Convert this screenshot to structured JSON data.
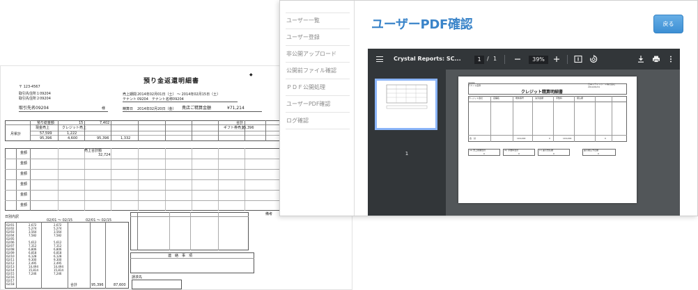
{
  "document": {
    "title": "預り金返還明細書",
    "postal": "〒 123-4567",
    "client_id1": "取引先住所１09204",
    "client_id2": "取引先住所２09204",
    "client_name": "取引先名09204",
    "honorific": "様",
    "sales_period_label": "売上期間",
    "sales_period": "2014年02月01日（土） ～ 2014年02月15日（土）",
    "tenant_label": "テナント",
    "tenant": "09204　テナント名称09204",
    "issue_date_label": "精算日",
    "issue_date": "2014年02月20日（金）",
    "return_label": "貴店ご精算金額",
    "return_amount": "¥71,214",
    "row_header1": "預り総金額",
    "row_header2": "現金売上",
    "row_header3": "クレジット売上",
    "row_header4": "ギフト券売上",
    "total_label": "合計",
    "monthly_label": "月累計",
    "amount_label": "金額",
    "col_sales_total": "売上合計額",
    "sales_total": "95,396",
    "totals_row": "95,396",
    "val_a": "57,599",
    "val_b": "15",
    "val_c": "7,402",
    "val_d": "1,222",
    "val_e": "4,600",
    "val_f": "1,332",
    "val_g": "32,724",
    "daily_label": "日別内訳",
    "daily_period1": "02/01 ～ 02/15",
    "daily_period2": "02/01 ～ 02/15",
    "daily_rows": [
      "02/01",
      "02/02",
      "02/03",
      "02/04",
      "02/05",
      "02/06",
      "02/07",
      "02/08",
      "02/09",
      "02/10",
      "02/11",
      "02/12",
      "02/13",
      "02/14",
      "02/15",
      "02/16",
      "02/17",
      "02/18"
    ],
    "daily_vals": [
      "2,672",
      "5,274",
      "3,564",
      "7,582",
      "",
      "5,612",
      "7,312",
      "6,806",
      "6,818",
      "6,128",
      "9,300",
      "2,495",
      "14,494",
      "15,814",
      "7,246",
      "",
      "",
      ""
    ],
    "daily_total_label": "合計",
    "daily_total": "95,396",
    "daily_total2": "87,600",
    "note_header": "連　絡　事　項",
    "bottom_label": "請求先",
    "remarks_label": "備考"
  },
  "window": {
    "menu": [
      "ユーザー一覧",
      "ユーザー登録",
      "非公開アップロード",
      "公開前ファイル確認",
      "ＰＤＦ公開処理",
      "ユーザーPDF確認",
      "ログ確認"
    ],
    "page_title": "ユーザーPDF確認",
    "back_label": "戻る"
  },
  "viewer": {
    "doc_title": "Crystal Reports: SC...",
    "page_current": "1",
    "page_sep": "/",
    "page_total": "1",
    "zoom": "39%",
    "thumb_label": "1"
  },
  "pdf_page": {
    "title": "クレジット精算明細書",
    "header_left1": "00000",
    "header_left2": "テナント名称",
    "header_right1": "日本ステイツカード株式会社",
    "header_right2": "2014/02/21",
    "label_col1": "店舗名",
    "label_col2": "端末番号",
    "label_col3": "決済金額",
    "label_col4": "手数料",
    "label_col5": "振込額",
    "side_label": "クレジット会社",
    "row_amount": "104,000",
    "row_zero": "0",
    "total_label": "合　計",
    "box1_label": "(a) 売上総額合計",
    "box2_label": "(b) 手数料合計",
    "box3_label": "(c) 差引支払額",
    "box4_label": "差引振込予定額",
    "box_val": "0"
  },
  "colors": {
    "accent": "#3a84c9",
    "button": "#4c9bdc",
    "viewer_bar": "#323639",
    "viewer_bg": "#525659"
  },
  "icons": [
    "hamburger-menu-icon",
    "zoom-out-icon",
    "zoom-in-icon",
    "fit-page-icon",
    "rotate-icon",
    "download-icon",
    "print-icon",
    "more-vert-icon"
  ]
}
